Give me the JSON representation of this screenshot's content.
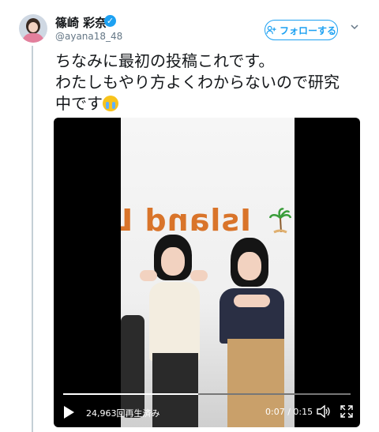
{
  "tweet": {
    "user": {
      "display_name": "篠崎 彩奈",
      "handle": "@ayana18_48",
      "verified": true
    },
    "follow_button": {
      "label": "フォローする",
      "icon": "add-user-icon"
    },
    "text_line1": "ちなみに最初の投稿これです。",
    "text_line2": "わたしもやり方よくわからないので研究",
    "text_line3": "中です",
    "text_emoji": "loudly-crying-face-emoji"
  },
  "video": {
    "wall_sign": "Island L",
    "view_count": "24,963回再生済み",
    "time_display": "0:07 / 0:15",
    "progress": 0.47,
    "controls": [
      "play-icon",
      "volume-icon",
      "fullscreen-icon"
    ]
  },
  "colors": {
    "brand": "#1da1f2",
    "thread_line": "#c4cfd6",
    "handle_gray": "#657786"
  }
}
